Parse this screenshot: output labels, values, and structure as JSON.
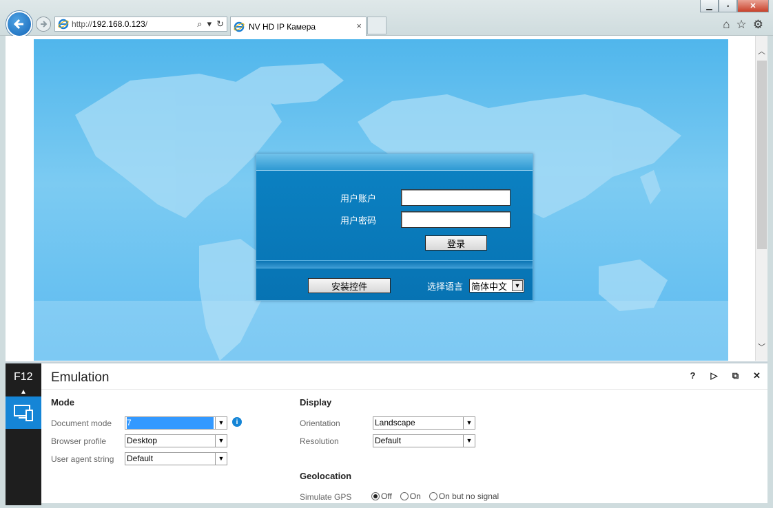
{
  "browser": {
    "url_scheme": "http://",
    "url_host": "192.168.0.123",
    "url_path": "/",
    "tab_title": "NV HD IP Камера",
    "tab_close": "×",
    "window_controls": {
      "minimize": "▁",
      "maximize": "▫",
      "close": "✕"
    },
    "tools": {
      "home": "⌂",
      "favorites": "☆",
      "settings": "⚙"
    }
  },
  "login": {
    "username_label": "用户账户",
    "password_label": "用户密码",
    "login_button": "登录",
    "install_button": "安装控件",
    "language_label": "选择语言",
    "language_value": "简体中文"
  },
  "devtools": {
    "f12_label": "F12",
    "title": "Emulation",
    "header_buttons": {
      "help": "?",
      "console": "▷",
      "undock": "⧉",
      "close": "✕"
    },
    "mode": {
      "heading": "Mode",
      "document_mode_label": "Document mode",
      "document_mode_value": "7",
      "browser_profile_label": "Browser profile",
      "browser_profile_value": "Desktop",
      "user_agent_label": "User agent string",
      "user_agent_value": "Default"
    },
    "display": {
      "heading": "Display",
      "orientation_label": "Orientation",
      "orientation_value": "Landscape",
      "resolution_label": "Resolution",
      "resolution_value": "Default"
    },
    "geolocation": {
      "heading": "Geolocation",
      "simulate_gps_label": "Simulate GPS",
      "options": [
        "Off",
        "On",
        "On but no signal"
      ],
      "selected": "Off"
    }
  },
  "colors": {
    "accent": "#1585d6",
    "login_panel": "#0a7bbd",
    "map_sky": "#5cbaf0"
  }
}
